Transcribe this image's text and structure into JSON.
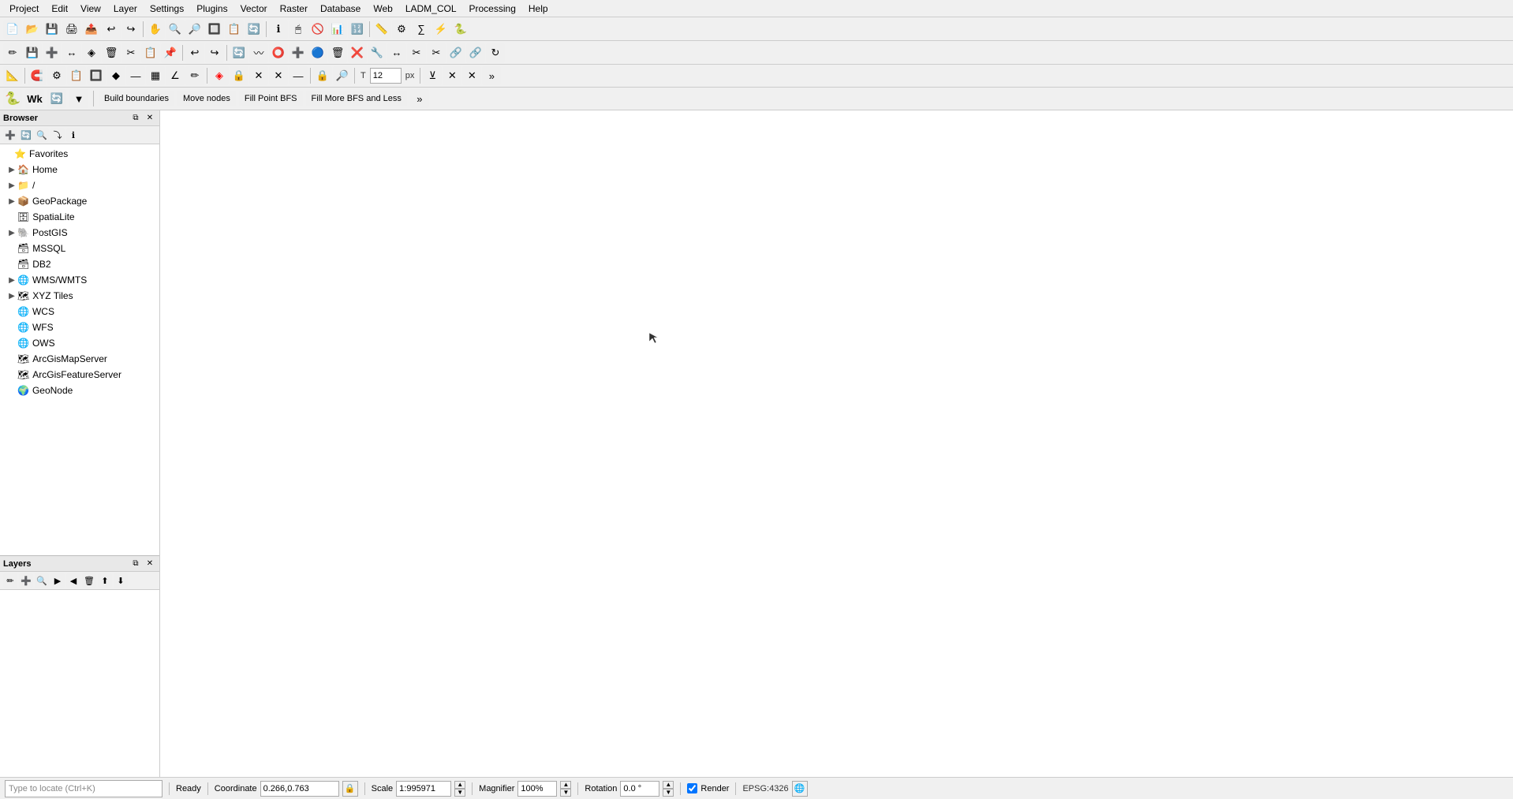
{
  "menubar": {
    "items": [
      "Project",
      "Edit",
      "View",
      "Layer",
      "Settings",
      "Plugins",
      "Vector",
      "Raster",
      "Database",
      "Web",
      "LADM_COL",
      "Processing",
      "Help"
    ]
  },
  "toolbars": {
    "toolbar1_buttons": [
      "📄",
      "📂",
      "💾",
      "🖨",
      "📤",
      "🔍",
      "➕",
      "✏️",
      "🗑"
    ],
    "toolbar2_buttons": [
      "✋",
      "⬡",
      "➕",
      "🔍",
      "🔎",
      "🔲",
      "📋",
      "🔄",
      "🔍",
      "🔍",
      "🔍",
      "🔍",
      "🔲",
      "📋",
      "📋",
      "🔄"
    ],
    "adv_toolbar_labels": [
      "Build boundaries",
      "Move nodes",
      "Fill Point BFS",
      "Fill More BFS and Less"
    ],
    "font_size": "12",
    "font_unit": "px"
  },
  "browser": {
    "title": "Browser",
    "items": [
      {
        "label": "Favorites",
        "indent": 0,
        "has_arrow": false,
        "icon": "⭐"
      },
      {
        "label": "Home",
        "indent": 1,
        "has_arrow": true,
        "icon": "🏠"
      },
      {
        "label": "/",
        "indent": 1,
        "has_arrow": true,
        "icon": "📁"
      },
      {
        "label": "GeoPackage",
        "indent": 1,
        "has_arrow": true,
        "icon": "📦"
      },
      {
        "label": "SpatiaLite",
        "indent": 1,
        "has_arrow": false,
        "icon": "🗄"
      },
      {
        "label": "PostGIS",
        "indent": 1,
        "has_arrow": true,
        "icon": "🐘"
      },
      {
        "label": "MSSQL",
        "indent": 1,
        "has_arrow": false,
        "icon": "🗃"
      },
      {
        "label": "DB2",
        "indent": 1,
        "has_arrow": false,
        "icon": "🗃"
      },
      {
        "label": "WMS/WMTS",
        "indent": 1,
        "has_arrow": true,
        "icon": "🌐"
      },
      {
        "label": "XYZ Tiles",
        "indent": 1,
        "has_arrow": true,
        "icon": "🗺"
      },
      {
        "label": "WCS",
        "indent": 1,
        "has_arrow": false,
        "icon": "🌐"
      },
      {
        "label": "WFS",
        "indent": 1,
        "has_arrow": false,
        "icon": "🌐"
      },
      {
        "label": "OWS",
        "indent": 1,
        "has_arrow": false,
        "icon": "🌐"
      },
      {
        "label": "ArcGisMapServer",
        "indent": 1,
        "has_arrow": false,
        "icon": "🗺"
      },
      {
        "label": "ArcGisFeatureServer",
        "indent": 1,
        "has_arrow": false,
        "icon": "🗺"
      },
      {
        "label": "GeoNode",
        "indent": 1,
        "has_arrow": false,
        "icon": "🌍"
      }
    ]
  },
  "layers": {
    "title": "Layers"
  },
  "statusbar": {
    "ready_text": "Ready",
    "coordinate_label": "Coordinate",
    "coordinate_value": "0.266,0.763",
    "scale_label": "Scale",
    "scale_value": "1:995971",
    "magnifier_label": "Magnifier",
    "magnifier_value": "100%",
    "rotation_label": "Rotation",
    "rotation_value": "0.0 °",
    "render_label": "Render",
    "epsg_label": "EPSG:4326",
    "search_placeholder": "Type to locate (Ctrl+K)"
  },
  "map": {
    "bg_color": "#ffffff"
  }
}
